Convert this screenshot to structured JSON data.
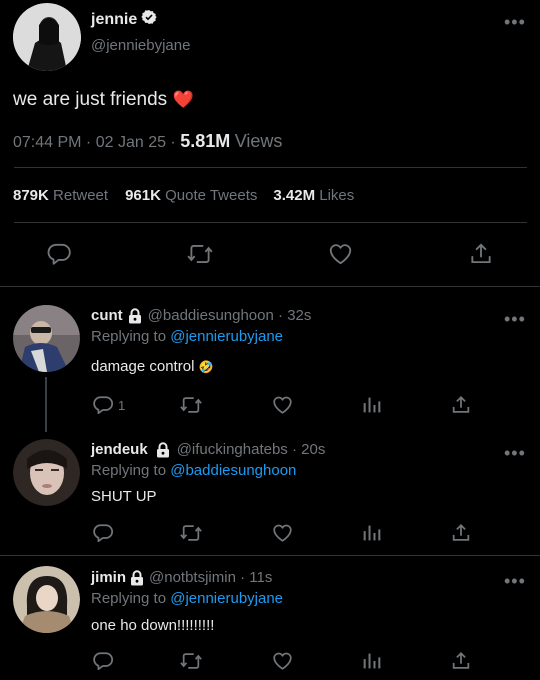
{
  "main_tweet": {
    "display_name": "jennie",
    "handle": "@jenniebyjane",
    "text": "we are just friends",
    "emoji": "❤️",
    "time": "07:44 PM",
    "date": "02 Jan 25",
    "views_count": "5.81M",
    "views_label": "Views",
    "retweets_count": "879K",
    "retweets_label": "Retweet",
    "quotes_count": "961K",
    "quotes_label": "Quote Tweets",
    "likes_count": "3.42M",
    "likes_label": "Likes"
  },
  "replies": [
    {
      "display_name": "cunt",
      "handle": "@baddiesunghoon",
      "time": "32s",
      "replying_label": "Replying to",
      "replying_to": "@jennierubyjane",
      "text": "damage control",
      "emoji": "🤣",
      "reply_count": "1"
    },
    {
      "display_name": "jendeuk",
      "handle": "@ifuckinghatebs",
      "time": "20s",
      "replying_label": "Replying to",
      "replying_to": "@baddiesunghoon",
      "text": "SHUT UP"
    },
    {
      "display_name": "jimin",
      "handle": "@notbtsjimin",
      "time": "11s",
      "replying_label": "Replying to",
      "replying_to": "@jennierubyjane",
      "text": "one ho down!!!!!!!!!"
    }
  ],
  "colors": {
    "background": "#000000",
    "text": "#e7e9ea",
    "muted": "#71767b",
    "link": "#1d9bf0",
    "heart": "#f4212e",
    "divider": "#2f3336"
  },
  "icons": [
    "verified-badge-icon",
    "more-icon",
    "reply-icon",
    "retweet-icon",
    "like-icon",
    "share-icon",
    "analytics-icon",
    "lock-icon"
  ]
}
